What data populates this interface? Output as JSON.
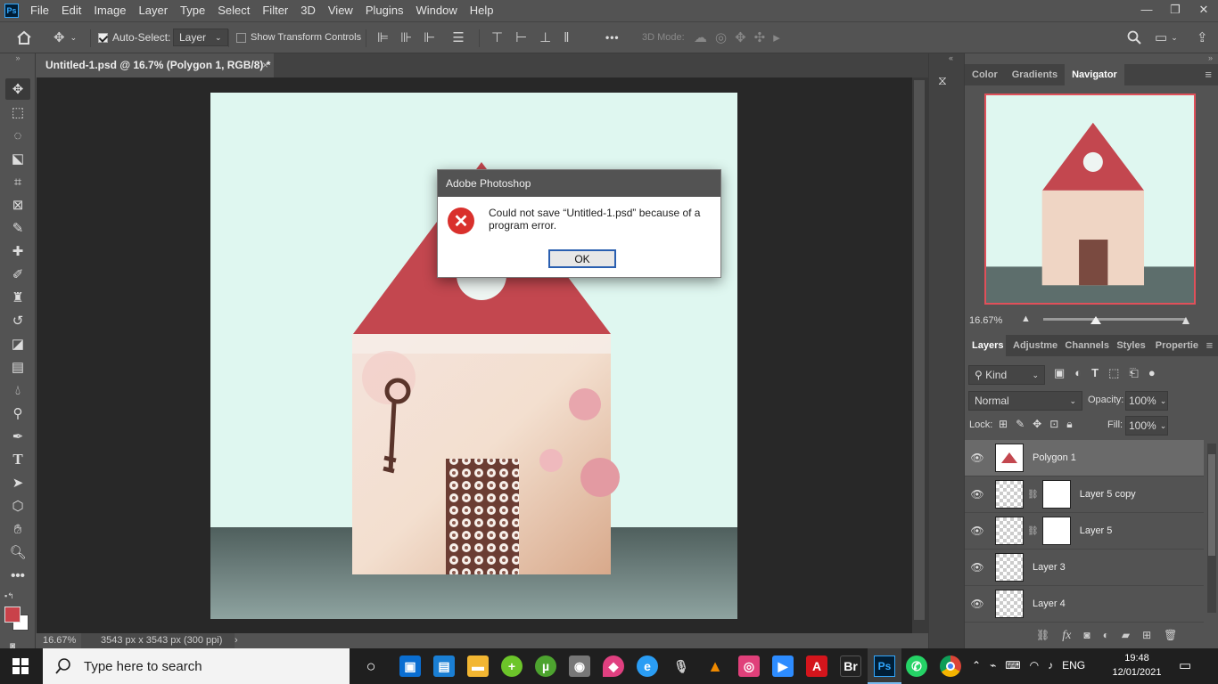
{
  "app": {
    "logo": "Ps"
  },
  "menu": [
    "File",
    "Edit",
    "Image",
    "Layer",
    "Type",
    "Select",
    "Filter",
    "3D",
    "View",
    "Plugins",
    "Window",
    "Help"
  ],
  "window_controls": {
    "minimize": "—",
    "restore": "❐",
    "close": "✕"
  },
  "options": {
    "auto_select_label": "Auto-Select:",
    "auto_select_checked": true,
    "target_value": "Layer",
    "show_transform_label": "Show Transform Controls",
    "show_transform_checked": false,
    "more": "•••",
    "mode_3d_label": "3D Mode:"
  },
  "document": {
    "tab_title": "Untitled-1.psd @ 16.7% (Polygon 1, RGB/8) *",
    "tab_close": "×",
    "zoom": "16.67%",
    "size_info": "3543 px x 3543 px (300 ppi)",
    "status_arrow": "›"
  },
  "colors": {
    "foreground": "#c9424a",
    "background": "#ffffff",
    "roof": "#c3474f",
    "sky": "#dff7f0",
    "floor": "#5b6b69",
    "accent": "#31a8ff"
  },
  "navigator": {
    "tabs": [
      {
        "label": "Color"
      },
      {
        "label": "Gradients"
      },
      {
        "label": "Navigator"
      }
    ],
    "active_tab": "Navigator",
    "zoom": "16.67%",
    "slider_fraction": 0.37
  },
  "layers_panel": {
    "tabs": [
      {
        "label": "Layers"
      },
      {
        "label": "Adjustme"
      },
      {
        "label": "Channels"
      },
      {
        "label": "Styles"
      },
      {
        "label": "Propertie"
      }
    ],
    "filter_kind": "Kind",
    "blend_mode": "Normal",
    "opacity_label": "Opacity:",
    "opacity": "100%",
    "lock_label": "Lock:",
    "fill_label": "Fill:",
    "fill": "100%",
    "layers": [
      {
        "name": "Polygon 1",
        "selected": true,
        "has_mask": false
      },
      {
        "name": "Layer 5 copy",
        "selected": false,
        "has_mask": true
      },
      {
        "name": "Layer 5",
        "selected": false,
        "has_mask": true
      },
      {
        "name": "Layer 3",
        "selected": false,
        "has_mask": false
      },
      {
        "name": "Layer 4",
        "selected": false,
        "has_mask": false
      }
    ],
    "footer_icons": [
      "link-icon",
      "fx-icon",
      "mask-icon",
      "adjustment-icon",
      "folder-icon",
      "new-layer-icon",
      "trash-icon"
    ],
    "fx": "fx"
  },
  "dialog": {
    "title": "Adobe Photoshop",
    "message": "Could not save “Untitled-1.psd” because of a program error.",
    "ok_label": "OK",
    "error_glyph": "✕"
  },
  "taskbar": {
    "search_placeholder": "Type here to search",
    "language": "ENG",
    "time": "19:48",
    "date": "12/01/2021",
    "apps": [
      "cortana-icon",
      "store-icon",
      "news-icon",
      "explorer-icon",
      "plus-icon",
      "utorrent-icon",
      "camera-icon",
      "paint-icon",
      "edge-icon",
      "podcast-icon",
      "vlc-icon",
      "creative-icon",
      "zoom-icon",
      "acrobat-icon",
      "bridge-icon",
      "photoshop-icon",
      "whatsapp-icon",
      "chrome-icon"
    ],
    "bridge_label": "Br",
    "ps_label": "Ps"
  }
}
